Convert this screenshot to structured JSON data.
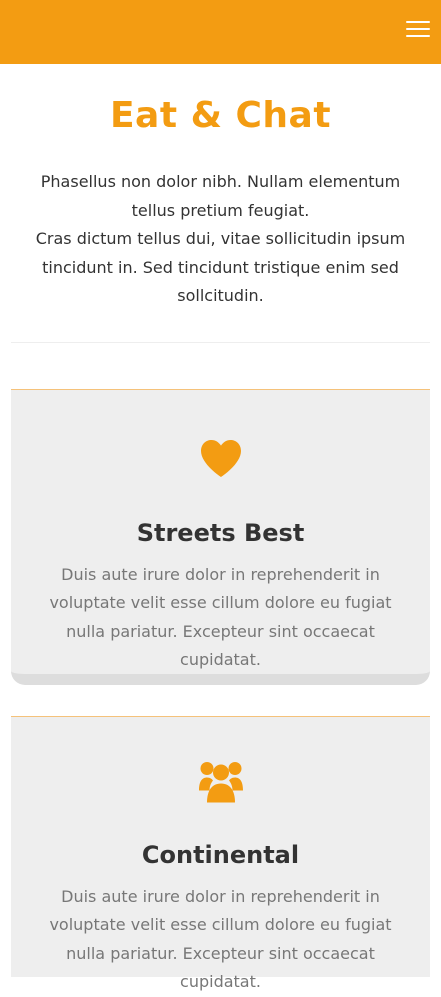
{
  "header": {
    "menu_icon": "hamburger-menu-icon",
    "brand_color": "#f39c12"
  },
  "hero": {
    "title": "Eat & Chat",
    "intro_line1": "Phasellus non dolor nibh. Nullam elementum tellus pretium feugiat.",
    "intro_line2": "Cras dictum tellus dui, vitae sollicitudin ipsum tincidunt in. Sed tincidunt tristique enim sed sollcitudin."
  },
  "features": [
    {
      "icon": "heart-icon",
      "title": "Streets Best",
      "text": "Duis aute irure dolor in reprehenderit in voluptate velit esse cillum dolore eu fugiat nulla pariatur. Excepteur sint occaecat cupidatat."
    },
    {
      "icon": "users-icon",
      "title": "Continental",
      "text": "Duis aute irure dolor in reprehenderit in voluptate velit esse cillum dolore eu fugiat nulla pariatur. Excepteur sint occaecat cupidatat."
    }
  ]
}
